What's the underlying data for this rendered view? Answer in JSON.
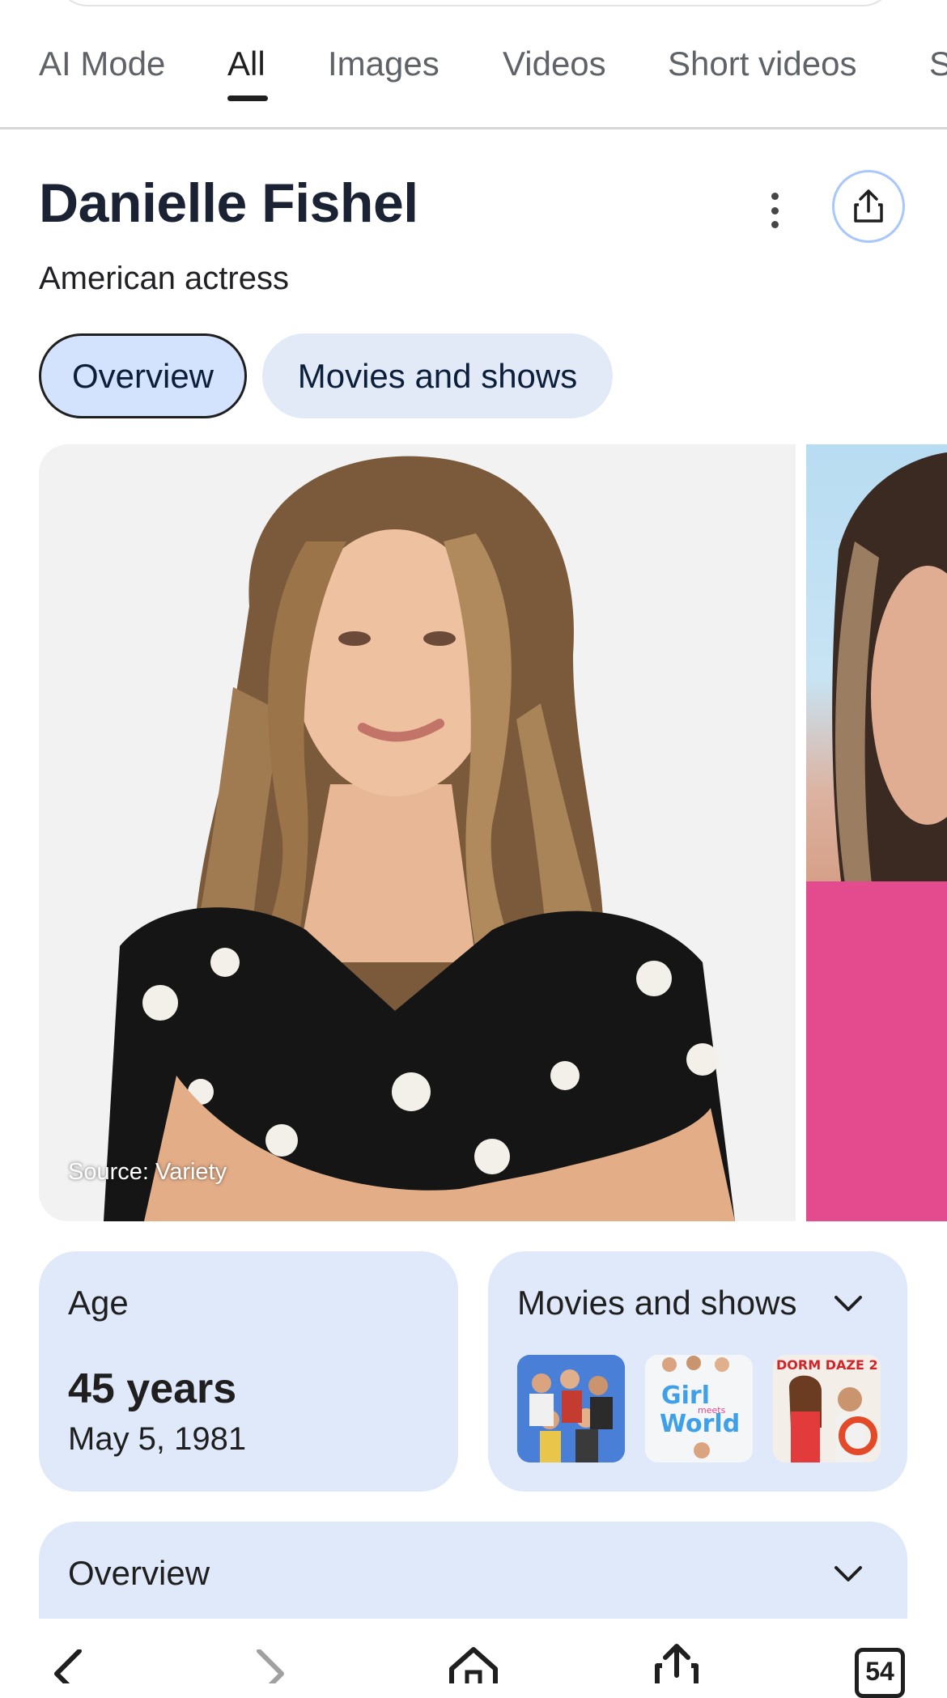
{
  "tabs": [
    {
      "label": "AI Mode"
    },
    {
      "label": "All"
    },
    {
      "label": "Images"
    },
    {
      "label": "Videos"
    },
    {
      "label": "Short videos"
    },
    {
      "label": "S"
    }
  ],
  "entity": {
    "name": "Danielle Fishel",
    "description": "American actress"
  },
  "chips": {
    "overview": "Overview",
    "movies": "Movies and shows"
  },
  "image": {
    "source": "Source: Variety"
  },
  "age_card": {
    "label": "Age",
    "value": "45 years",
    "date": "May 5, 1981"
  },
  "movies_card": {
    "label": "Movies and shows"
  },
  "overview_card": {
    "label": "Overview"
  },
  "bottom_nav": {
    "tabs_count": "54"
  },
  "colors": {
    "chip_active": "#d3e3fd",
    "card_bg": "#e0e9fa",
    "title": "#1a2233"
  }
}
